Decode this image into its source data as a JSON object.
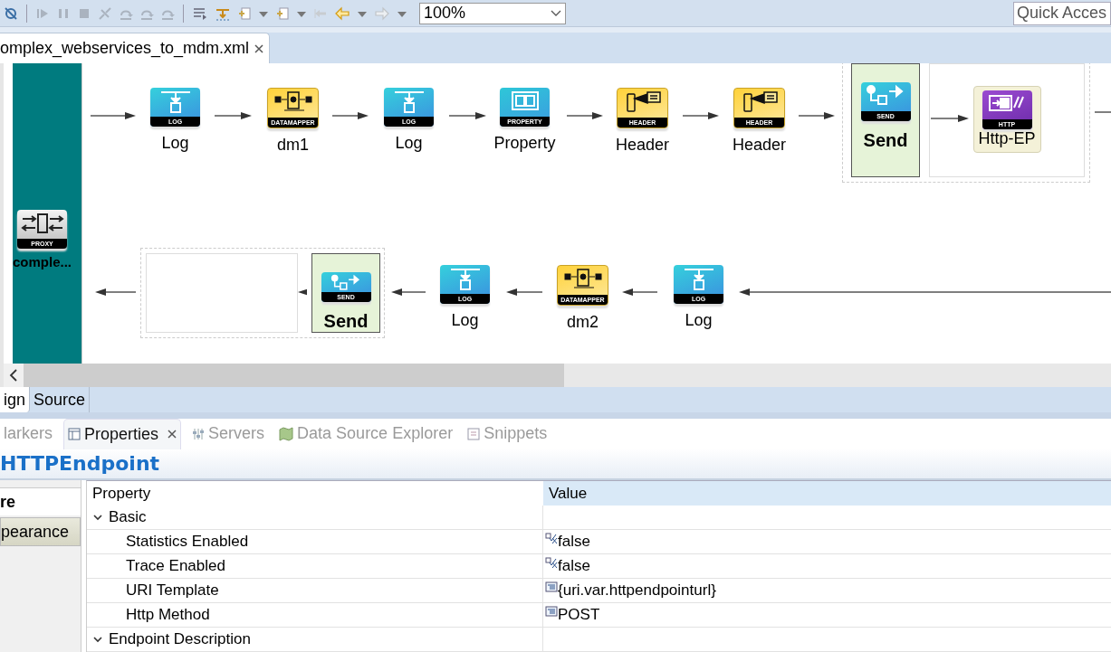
{
  "toolbar": {
    "zoom": "100%",
    "quick_access": "Quick Acces"
  },
  "editor_tabs": [
    {
      "label": "omplex_webservices_to_mdm.xml",
      "selected": true
    }
  ],
  "flow": {
    "proxy": {
      "badge": "PROXY",
      "label": "comple..."
    },
    "top_row": [
      {
        "kind": "log",
        "badge": "LOG",
        "label": "Log"
      },
      {
        "kind": "datamapper",
        "badge": "DATAMAPPER",
        "label": "dm1"
      },
      {
        "kind": "log",
        "badge": "LOG",
        "label": "Log"
      },
      {
        "kind": "property",
        "badge": "PROPERTY",
        "label": "Property"
      },
      {
        "kind": "header",
        "badge": "HEADER",
        "label": "Header"
      },
      {
        "kind": "header",
        "badge": "HEADER",
        "label": "Header"
      },
      {
        "kind": "send",
        "badge": "SEND",
        "label": "Send"
      },
      {
        "kind": "http",
        "badge": "HTTP",
        "label": "Http-EP"
      }
    ],
    "bottom_row": [
      {
        "kind": "send",
        "badge": "SEND",
        "label": "Send"
      },
      {
        "kind": "log",
        "badge": "LOG",
        "label": "Log"
      },
      {
        "kind": "datamapper",
        "badge": "DATAMAPPER",
        "label": "dm2"
      },
      {
        "kind": "log",
        "badge": "LOG",
        "label": "Log"
      }
    ]
  },
  "page_tabs": [
    {
      "label": "ign",
      "selected": true
    },
    {
      "label": "Source",
      "selected": false
    }
  ],
  "view_tabs": [
    {
      "label": "larkers",
      "selected": false,
      "kind": "markers"
    },
    {
      "label": "Properties",
      "selected": true,
      "kind": "properties"
    },
    {
      "label": "Servers",
      "selected": false,
      "kind": "servers"
    },
    {
      "label": "Data Source Explorer",
      "selected": false,
      "kind": "datasource"
    },
    {
      "label": "Snippets",
      "selected": false,
      "kind": "snippets"
    }
  ],
  "properties": {
    "title": "HTTPEndpoint",
    "side_tabs": [
      {
        "label": "re",
        "selected": true
      },
      {
        "label": "pearance",
        "selected": false
      }
    ],
    "columns": [
      "Property",
      "Value"
    ],
    "rows": [
      {
        "name": "Basic",
        "expanded": true,
        "children": [
          {
            "name": "Statistics Enabled",
            "value": "false",
            "kind": "boolean"
          },
          {
            "name": "Trace Enabled",
            "value": "false",
            "kind": "boolean"
          },
          {
            "name": "URI Template",
            "value": "{uri.var.httpendpointurl}",
            "kind": "text"
          },
          {
            "name": "Http Method",
            "value": "POST",
            "kind": "text"
          }
        ]
      },
      {
        "name": "Endpoint Description",
        "expanded": true
      }
    ]
  }
}
